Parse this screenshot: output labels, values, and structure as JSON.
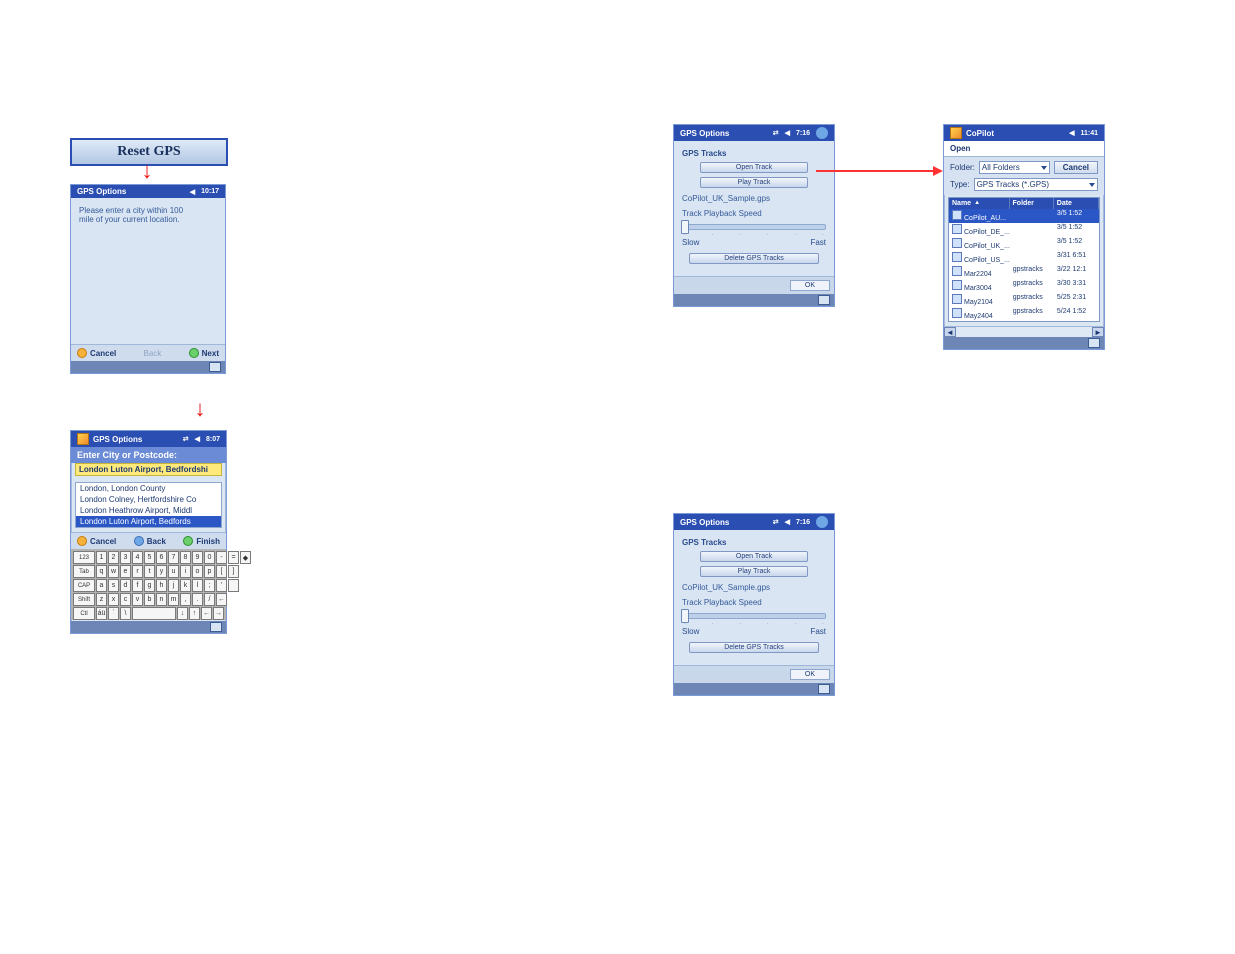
{
  "reset_button": {
    "label": "Reset GPS"
  },
  "panel_city_prompt": {
    "title": "GPS Options",
    "time": "10:17",
    "prompt1": "Please enter a city within 100",
    "prompt2": "mile of your current location.",
    "cancel": "Cancel",
    "back": "Back",
    "next": "Next"
  },
  "panel_city_entry": {
    "title": "GPS Options",
    "time": "8:07",
    "heading": "Enter City or Postcode:",
    "value": "London Luton Airport, Bedfordshi",
    "options": [
      "London, London County",
      "London Colney, Hertfordshire Co",
      "London Heathrow Airport, Middl",
      "London Luton Airport, Bedfords"
    ],
    "cancel": "Cancel",
    "back": "Back",
    "finish": "Finish",
    "kb": {
      "r1": [
        "123",
        "1",
        "2",
        "3",
        "4",
        "5",
        "6",
        "7",
        "8",
        "9",
        "0",
        "-",
        "=",
        "◆"
      ],
      "r2": [
        "Tab",
        "q",
        "w",
        "e",
        "r",
        "t",
        "y",
        "u",
        "i",
        "o",
        "p",
        "[",
        "]"
      ],
      "r3": [
        "CAP",
        "a",
        "s",
        "d",
        "f",
        "g",
        "h",
        "j",
        "k",
        "l",
        ";",
        "'",
        " "
      ],
      "r4": [
        "Shift",
        "z",
        "x",
        "c",
        "v",
        "b",
        "n",
        "m",
        ",",
        ".",
        "/",
        "←"
      ],
      "r5": [
        "Ctl",
        "áü",
        "`",
        "\\",
        " ",
        "↓",
        "↑",
        "←",
        "→"
      ]
    }
  },
  "panel_tracks": {
    "title": "GPS Options",
    "time": "7:16",
    "section": "GPS Tracks",
    "open": "Open Track",
    "play": "Play Track",
    "filename": "CoPilot_UK_Sample.gps",
    "speed_label": "Track Playback Speed",
    "slow": "Slow",
    "fast": "Fast",
    "delete": "Delete GPS Tracks",
    "ok": "OK"
  },
  "panel_browser": {
    "title": "CoPilot",
    "time": "11:41",
    "open": "Open",
    "folder_label": "Folder:",
    "folder_value": "All Folders",
    "cancel": "Cancel",
    "type_label": "Type:",
    "type_value": "GPS Tracks (*.GPS)",
    "cols": {
      "name": "Name",
      "folder": "Folder",
      "date": "Date"
    },
    "rows": [
      {
        "name": "CoPilot_AU...",
        "folder": "",
        "date": "3/5 1:52",
        "selected": true
      },
      {
        "name": "CoPilot_DE_...",
        "folder": "",
        "date": "3/5 1:52"
      },
      {
        "name": "CoPilot_UK_...",
        "folder": "",
        "date": "3/5 1:52"
      },
      {
        "name": "CoPilot_US_...",
        "folder": "",
        "date": "3/31 6:51"
      },
      {
        "name": "Mar2204",
        "folder": "gpstracks",
        "date": "3/22 12:1"
      },
      {
        "name": "Mar3004",
        "folder": "gpstracks",
        "date": "3/30 3:31"
      },
      {
        "name": "May2104",
        "folder": "gpstracks",
        "date": "5/25 2:31"
      },
      {
        "name": "May2404",
        "folder": "gpstracks",
        "date": "5/24 1:52"
      }
    ]
  }
}
